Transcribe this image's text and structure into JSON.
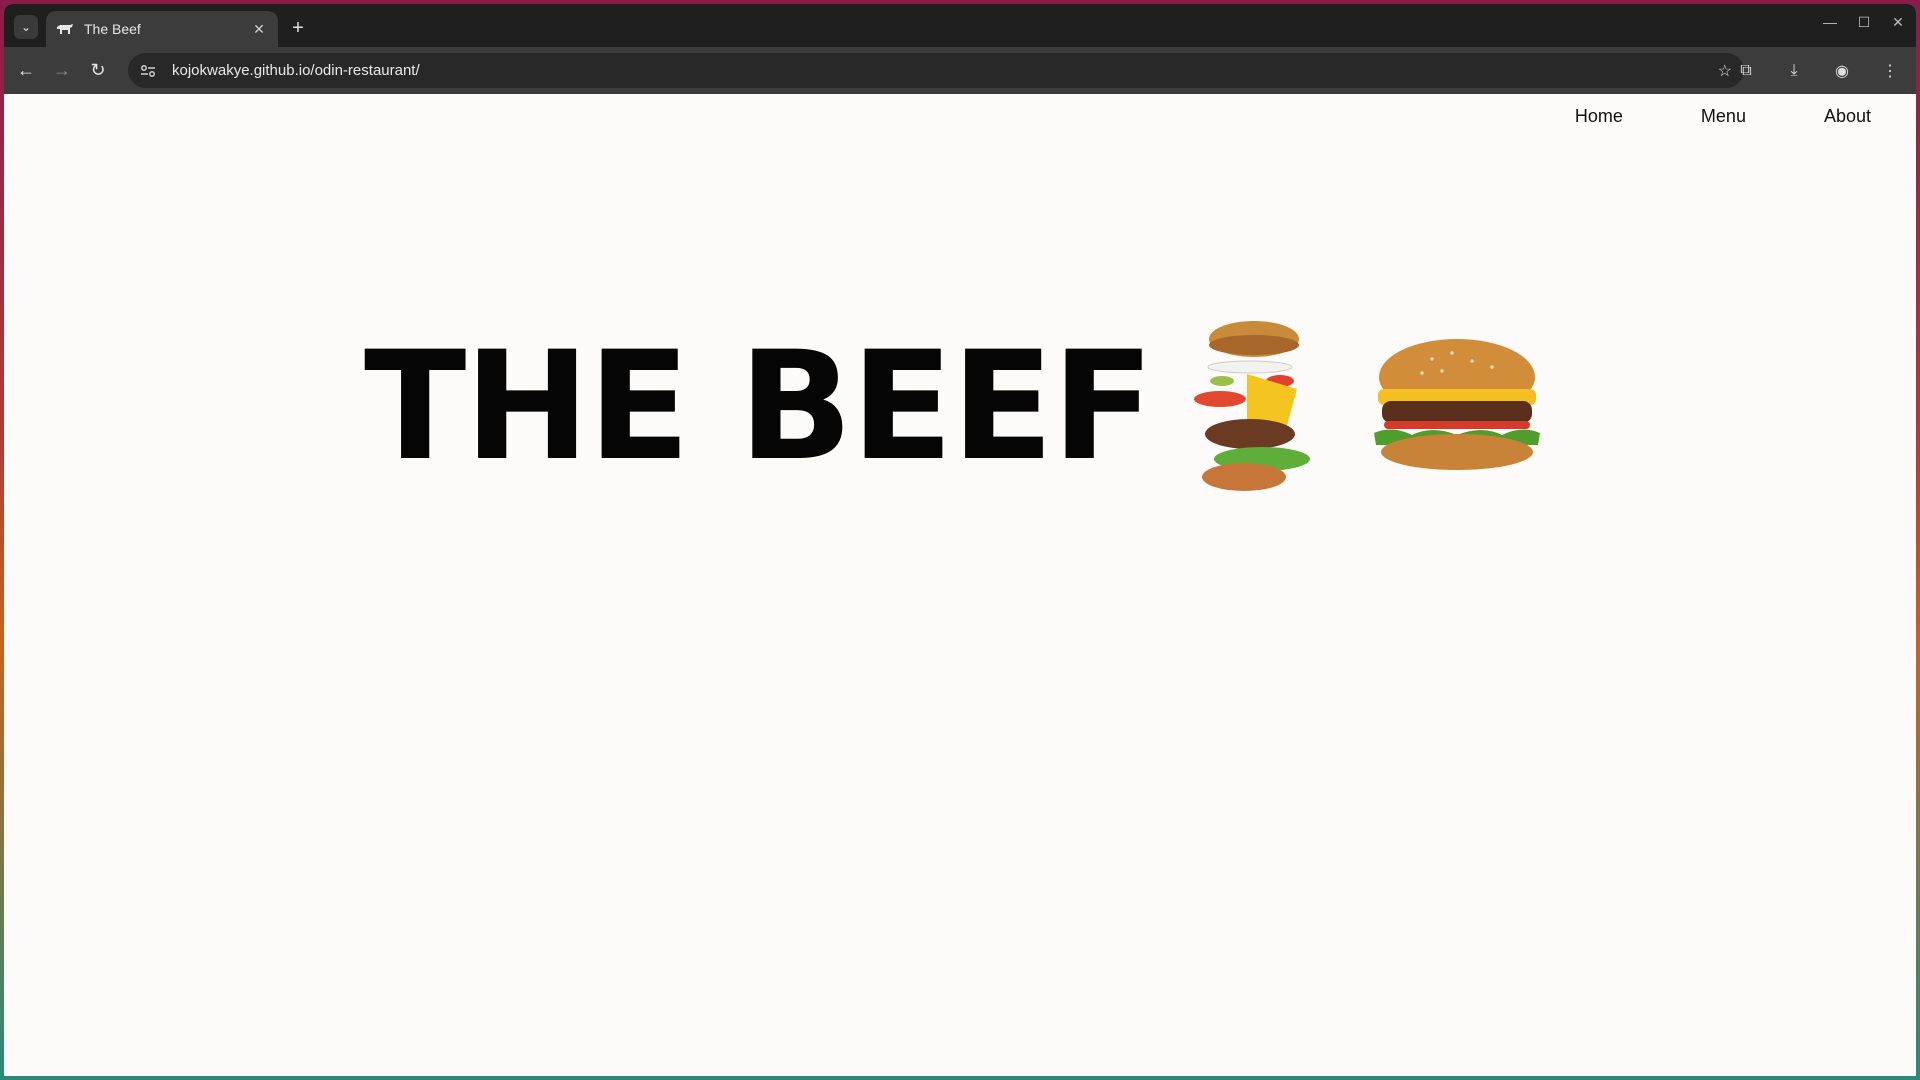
{
  "browser": {
    "tab_title": "The Beef",
    "url": "kojokwakye.github.io/odin-restaurant/"
  },
  "site": {
    "nav": [
      "Home",
      "Menu",
      "About"
    ],
    "hero_title": "THE BEEF"
  },
  "colors": {
    "page_bg": "#fcfbfa",
    "title": "#050505",
    "chrome_dark": "#1f1f1f",
    "toolbar": "#3c3c3c"
  }
}
